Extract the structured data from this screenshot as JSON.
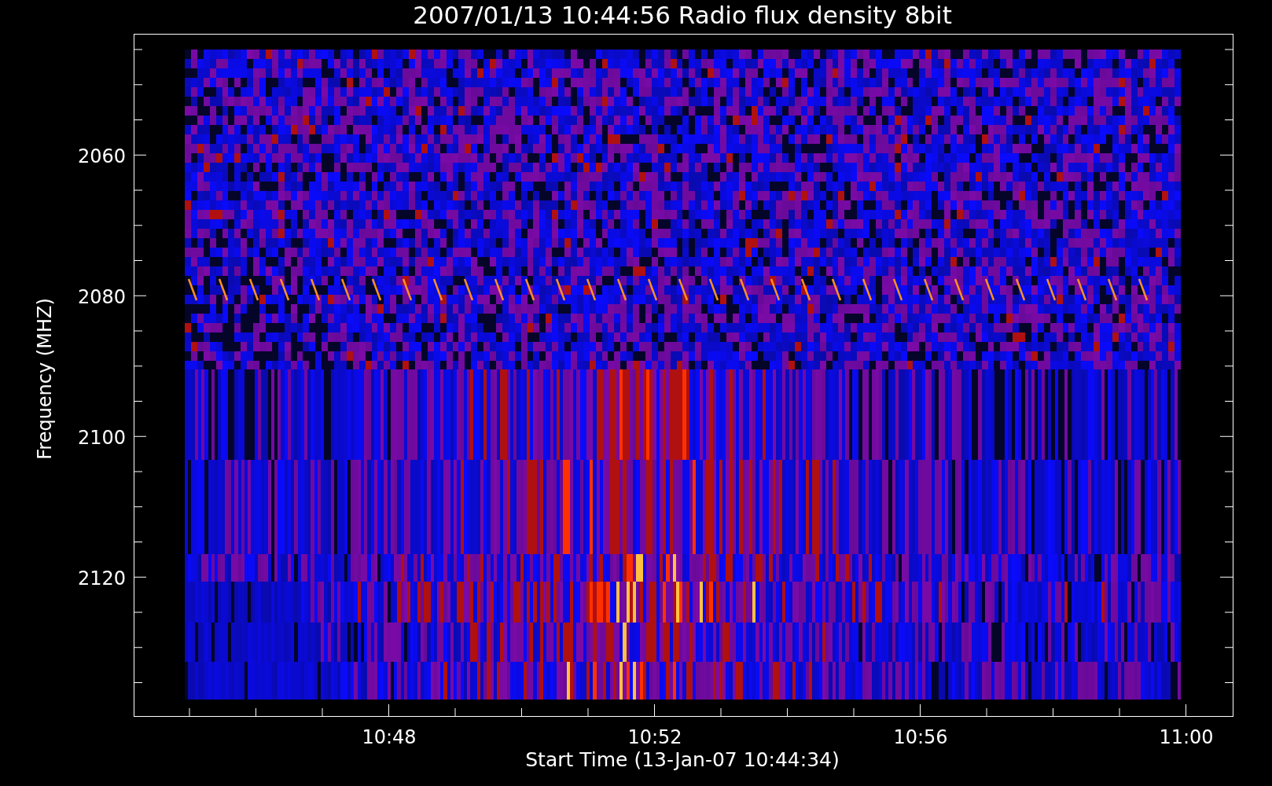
{
  "title": "2007/01/13 10:44:56 Radio flux density 8bit",
  "y_axis": {
    "label": "Frequency (MHZ)",
    "ticks": [
      "2060",
      "2080",
      "2100",
      "2120"
    ]
  },
  "x_axis": {
    "label": "Start Time (13-Jan-07 10:44:34)",
    "ticks": [
      "10:48",
      "10:52",
      "10:56",
      "11:00"
    ]
  }
}
